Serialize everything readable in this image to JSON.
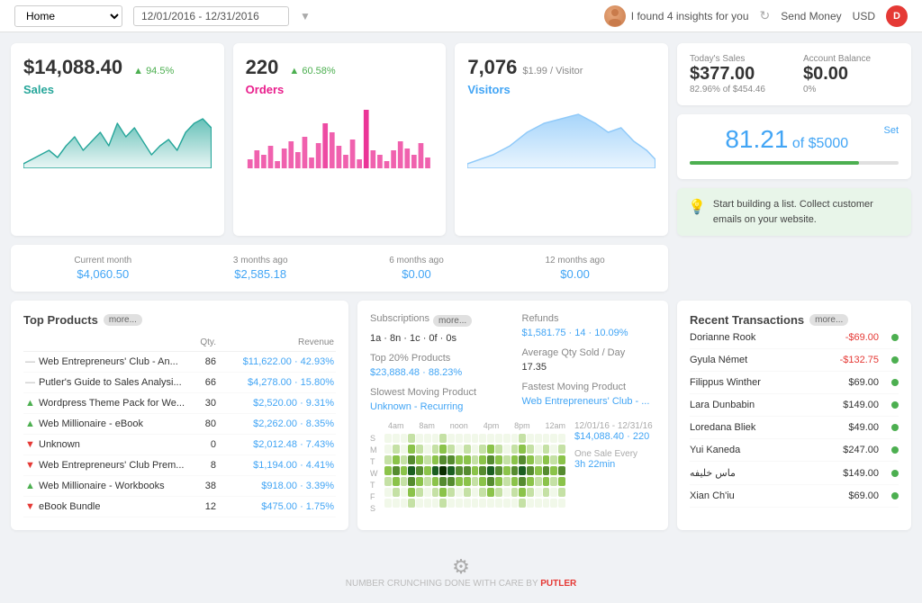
{
  "header": {
    "home_label": "Home",
    "date_range": "12/01/2016 - 12/31/2016",
    "insights_text": "I found 4 insights for you",
    "send_money": "Send Money",
    "currency": "USD",
    "user_initial": "D"
  },
  "sales_card": {
    "amount": "$14,088.40",
    "change": "94.5%",
    "label": "Sales"
  },
  "orders_card": {
    "amount": "220",
    "change": "60.58%",
    "label": "Orders"
  },
  "visitors_card": {
    "amount": "7,076",
    "sub": "$1.99 / Visitor",
    "label": "Visitors"
  },
  "todays_sales": {
    "label": "Today's Sales",
    "amount": "$377.00",
    "sub": "82.96% of $454.46"
  },
  "account_balance": {
    "label": "Account Balance",
    "amount": "$0.00",
    "sub": "0%"
  },
  "goal": {
    "percent": "81.21",
    "of": "of $5000",
    "set": "Set",
    "fill_width": "81"
  },
  "banner": {
    "text": "Start building a list. Collect customer emails on your website."
  },
  "periods": [
    {
      "label": "Current month",
      "amount": "$4,060.50"
    },
    {
      "label": "3 months ago",
      "amount": "$2,585.18"
    },
    {
      "label": "6 months ago",
      "amount": "$0.00"
    },
    {
      "label": "12 months ago",
      "amount": "$0.00"
    }
  ],
  "top_products": {
    "title": "Top Products",
    "more": "more...",
    "col_qty": "Qty.",
    "col_revenue": "Revenue",
    "items": [
      {
        "trend": "neutral",
        "name": "Web Entrepreneurs' Club - An...",
        "qty": "86",
        "revenue": "$11,622.00 · 42.93%"
      },
      {
        "trend": "neutral",
        "name": "Putler's Guide to Sales Analysi...",
        "qty": "66",
        "revenue": "$4,278.00 · 15.80%"
      },
      {
        "trend": "up",
        "name": "Wordpress Theme Pack for We...",
        "qty": "30",
        "revenue": "$2,520.00 · 9.31%"
      },
      {
        "trend": "up",
        "name": "Web Millionaire - eBook",
        "qty": "80",
        "revenue": "$2,262.00 · 8.35%"
      },
      {
        "trend": "down",
        "name": "Unknown",
        "qty": "0",
        "revenue": "$2,012.48 · 7.43%"
      },
      {
        "trend": "down",
        "name": "Web Entrepreneurs' Club Prem...",
        "qty": "8",
        "revenue": "$1,194.00 · 4.41%"
      },
      {
        "trend": "up",
        "name": "Web Millionaire - Workbooks",
        "qty": "38",
        "revenue": "$918.00 · 3.39%"
      },
      {
        "trend": "down",
        "name": "eBook Bundle",
        "qty": "12",
        "revenue": "$475.00 · 1.75%"
      }
    ]
  },
  "middle": {
    "subscriptions_label": "Subscriptions",
    "subscriptions_more": "more...",
    "subscriptions_val": "1a · 8n · 1c · 0f · 0s",
    "top20_label": "Top 20% Products",
    "top20_val": "$23,888.48 · 88.23%",
    "slowest_label": "Slowest Moving Product",
    "slowest_val": "Unknown - Recurring",
    "refunds_label": "Refunds",
    "refunds_val": "$1,581.75 · 14 · 10.09%",
    "avg_qty_label": "Average Qty Sold / Day",
    "avg_qty_val": "17.35",
    "fastest_label": "Fastest Moving Product",
    "fastest_val": "Web Entrepreneurs' Club - ...",
    "date_range": "12/01/16 - 12/31/16",
    "total": "$14,088.40 · 220",
    "one_sale": "One Sale Every",
    "one_sale_val": "3h 22min",
    "heatmap_time_labels": [
      "4am",
      "8am",
      "noon",
      "4pm",
      "8pm",
      "12am"
    ],
    "heatmap_day_labels": [
      "S",
      "M",
      "T",
      "W",
      "T",
      "F",
      "S"
    ]
  },
  "recent_transactions": {
    "title": "Recent Transactions",
    "more": "more...",
    "items": [
      {
        "name": "Dorianne Rook",
        "amount": "-$69.00"
      },
      {
        "name": "Gyula Német",
        "amount": "-$132.75"
      },
      {
        "name": "Filippus Winther",
        "amount": "$69.00"
      },
      {
        "name": "Lara Dunbabin",
        "amount": "$149.00"
      },
      {
        "name": "Loredana Bliek",
        "amount": "$49.00"
      },
      {
        "name": "Yui Kaneda",
        "amount": "$247.00"
      },
      {
        "name": "ماس خليفه",
        "amount": "$149.00"
      },
      {
        "name": "Xian Ch'iu",
        "amount": "$69.00"
      }
    ]
  },
  "footer": {
    "crunching": "NUMBER CRUNCHING DONE WITH CARE BY",
    "brand": "PUTLER"
  }
}
